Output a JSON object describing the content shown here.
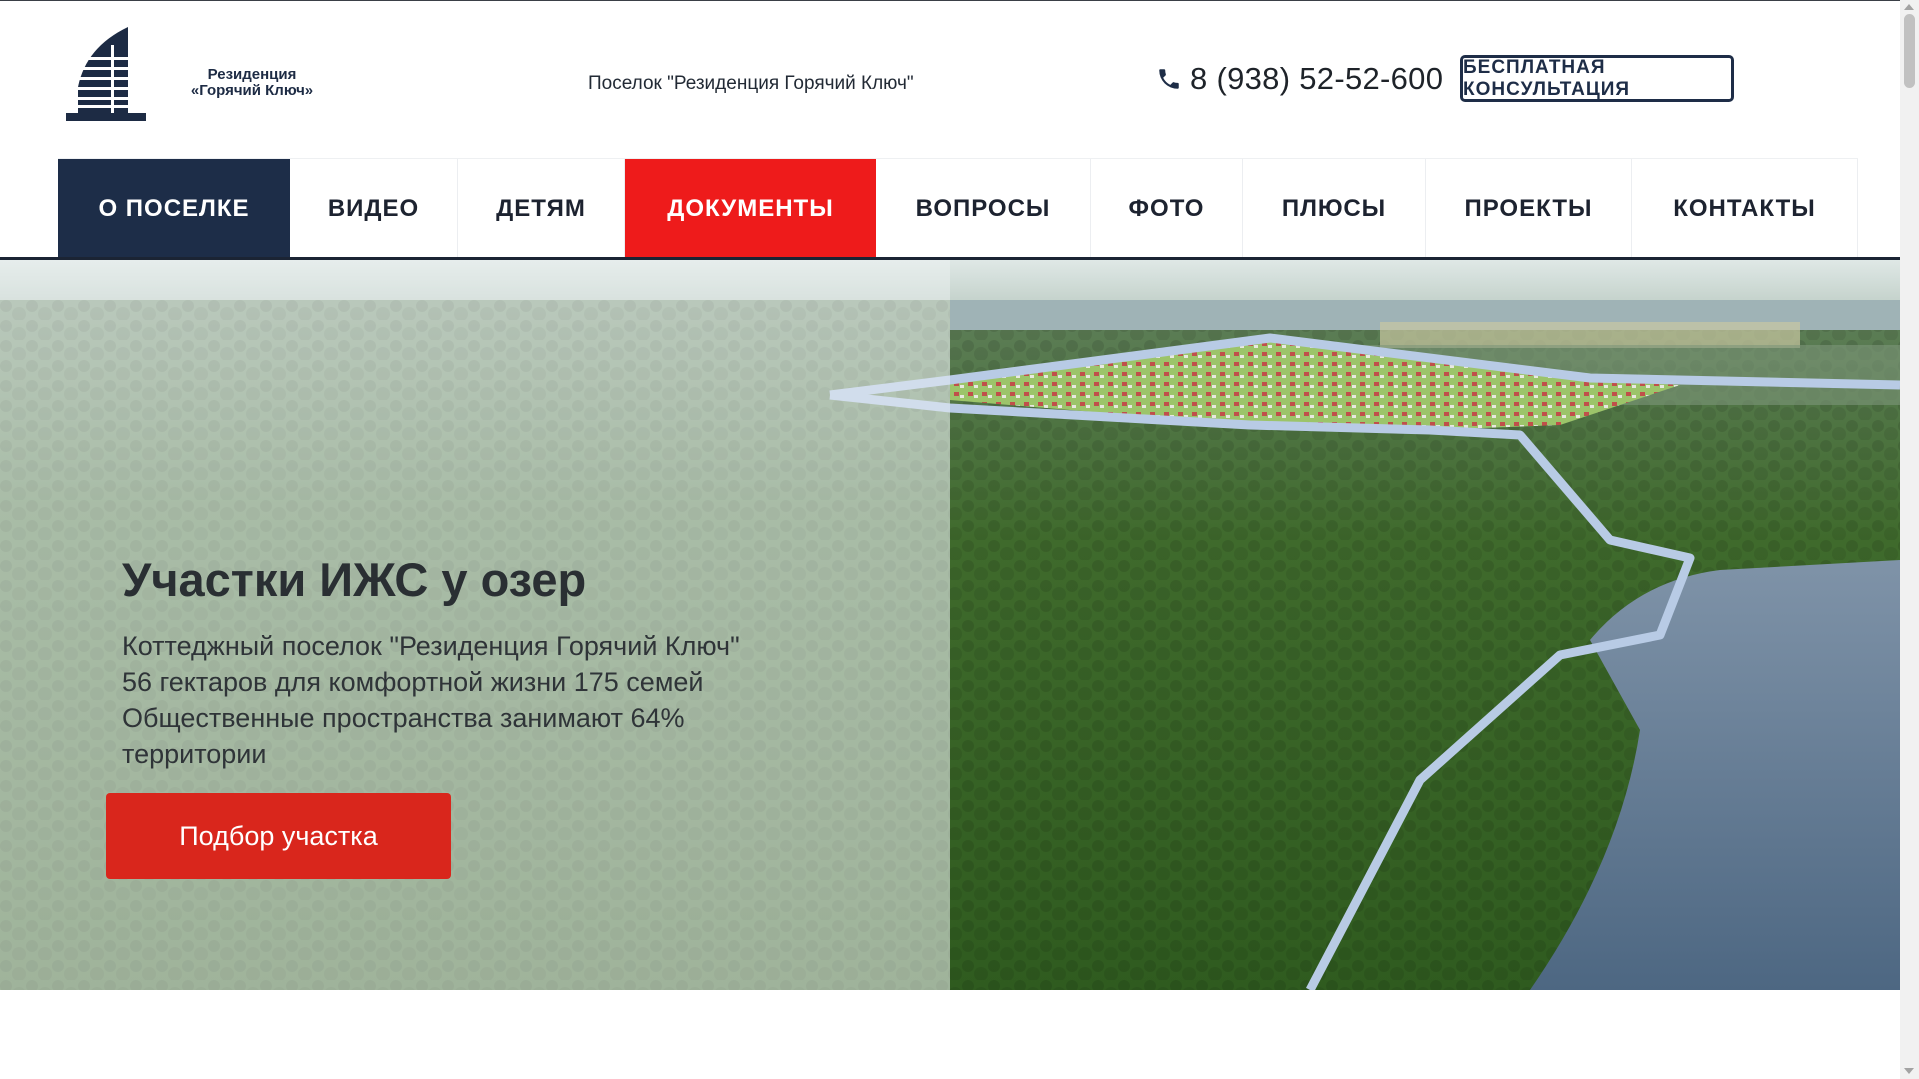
{
  "header": {
    "logo_text": [
      "Резиденция",
      "«Горячий Ключ»"
    ],
    "tagline": "Поселок \"Резиденция Горячий Ключ\"",
    "phone": "8 (938) 52-52-600",
    "phone_icon": "phone-icon",
    "cta_label": "БЕСПЛАТНАЯ КОНСУЛЬТАЦИЯ"
  },
  "nav": {
    "items": [
      {
        "label": "О ПОСЕЛКЕ",
        "state": "active"
      },
      {
        "label": "ВИДЕО"
      },
      {
        "label": "ДЕТЯМ"
      },
      {
        "label": "ДОКУМЕНТЫ",
        "state": "highlight"
      },
      {
        "label": "ВОПРОСЫ"
      },
      {
        "label": "ФОТО"
      },
      {
        "label": "ПЛЮСЫ"
      },
      {
        "label": "ПРОЕКТЫ"
      },
      {
        "label": "КОНТАКТЫ"
      }
    ]
  },
  "hero": {
    "title": "Участки ИЖС у озер",
    "lines": [
      "Коттеджный поселок \"Резиденция Горячий Ключ\"",
      "56 гектаров для комфортной жизни 175 семей",
      "Общественные пространства занимают 64%",
      "территории"
    ],
    "button_label": "Подбор участка"
  },
  "colors": {
    "brand_dark": "#1d2d48",
    "accent_red": "#ee1b1b",
    "button_red": "#d9261c"
  }
}
